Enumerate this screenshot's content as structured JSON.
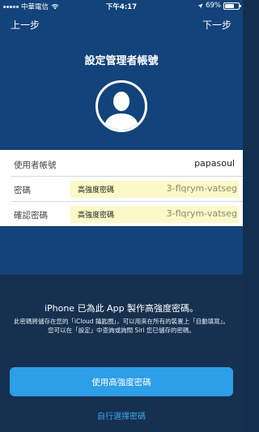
{
  "status_bar": {
    "carrier": "中華電信",
    "time": "下午4:17",
    "battery": "69%",
    "battery_level": 0.69
  },
  "nav": {
    "back_label": "上一步",
    "next_label": "下一步"
  },
  "page_title": "設定管理者帳號",
  "form": {
    "username_label": "使用者帳號",
    "username_value": "papasoul",
    "password_label": "密碼",
    "password_strong_tag": "高強度密碼",
    "password_generated": "3-flqrym-vatseg",
    "confirm_label": "確認密碼",
    "confirm_strong_tag": "高強度密碼",
    "confirm_generated": "3-flqrym-vatseg"
  },
  "sheet": {
    "title": "iPhone 已為此 App 製作高強度密碼。",
    "description": "此密碼將儲存在您的「iCloud 鑰匙圈」，可以用來在所有的裝置上「自動填寫」。您可以在「設定」中查詢或詢問 Siri 您已儲存的密碼。",
    "use_button": "使用高強度密碼",
    "choose_link": "自行選擇密碼"
  },
  "colors": {
    "header_bg": "#12437a",
    "sheet_bg": "#16304f",
    "button_bg": "#2d9ee8",
    "link": "#3aa6f0",
    "password_highlight": "#fbf9c8"
  }
}
